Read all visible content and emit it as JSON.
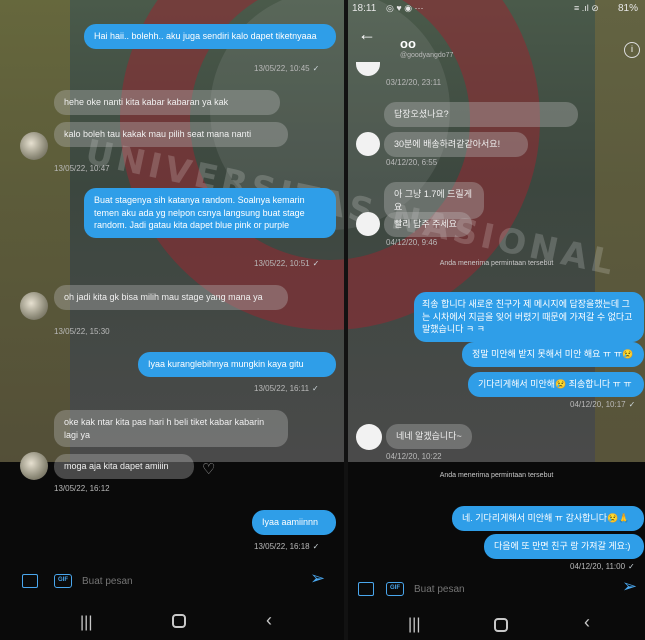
{
  "watermark": "UNIVERSITAS NASIONAL",
  "left": {
    "messages": [
      {
        "dir": "out",
        "text": "Hai haii.. bolehh.. aku juga sendiri kalo dapet tiketnyaaa",
        "time": "13/05/22, 10:45"
      },
      {
        "dir": "in",
        "text": "hehe oke nanti kita kabar kabaran ya kak"
      },
      {
        "dir": "in",
        "text": "kalo boleh tau kakak mau pilih seat mana nanti",
        "time": "13/05/22, 10:47"
      },
      {
        "dir": "out",
        "text": "Buat stagenya sih katanya random. Soalnya kemarin temen aku ada yg nelpon csnya langsung buat stage random. Jadi gatau kita dapet blue pink or purple",
        "time": "13/05/22, 10:51"
      },
      {
        "dir": "in",
        "text": "oh jadi kita gk bisa milih mau stage yang mana ya",
        "time": "13/05/22, 15:30"
      },
      {
        "dir": "out",
        "text": "Iyaa kuranglebihnya mungkin kaya gitu",
        "time": "13/05/22, 16:11"
      },
      {
        "dir": "in",
        "text": "oke kak ntar kita pas hari h beli tiket kabar kabarin lagi ya"
      },
      {
        "dir": "in",
        "text": "moga aja kita dapet amiiin",
        "time": "13/05/22, 16:12"
      },
      {
        "dir": "out",
        "text": "Iyaa aamiinnn",
        "time": "13/05/22, 16:18"
      }
    ],
    "input_placeholder": "Buat pesan",
    "gif_label": "GIF"
  },
  "right": {
    "status_time": "18:11",
    "status_icons": "◎ ♥ ◉ ···",
    "battery": "81%",
    "signal": "≡ .ıl ⊘",
    "contact_name": "oo",
    "contact_handle": "@goodyangdo77",
    "messages": [
      {
        "dir": "in",
        "time": "03/12/20, 23:11"
      },
      {
        "dir": "in",
        "text": "답장오셨나요?"
      },
      {
        "dir": "in",
        "text": "30분에 배송하려같같아서요!",
        "time": "04/12/20, 6:55"
      },
      {
        "dir": "in",
        "text": "아 그냥 1.7에 드릴게요"
      },
      {
        "dir": "in",
        "text": "빨리 답주 주세요",
        "time": "04/12/20, 9:46"
      },
      {
        "dir": "system",
        "text": "Anda menerima permintaan tersebut"
      },
      {
        "dir": "out",
        "text": "죄송 합니다 새로운 친구가 제 메시지에 답장을했는데 그는 시차에서 지금을 잊어 버렸기 때문에 가져갈 수 없다고 말했습니다 ㅋ ㅋ"
      },
      {
        "dir": "out",
        "text": "정말 미안해 받지 못해서 미안 해요 ㅠ ㅠ😢"
      },
      {
        "dir": "out",
        "text": "기다리게해서 미안해😢 죄송합니다 ㅠ ㅠ",
        "time": "04/12/20, 10:17"
      },
      {
        "dir": "in",
        "text": "네네 알겠습니다~",
        "time": "04/12/20, 10:22"
      },
      {
        "dir": "system",
        "text": "Anda menerima permintaan tersebut"
      },
      {
        "dir": "out",
        "text": "네. 기다리게해서 미안해 ㅠ 감사합니다😢🙏"
      },
      {
        "dir": "out",
        "text": "다음에 또 만면 친구 랑 가져갈 게요:)",
        "time": "04/12/20, 11:00"
      }
    ],
    "input_placeholder": "Buat pesan",
    "gif_label": "GIF"
  }
}
